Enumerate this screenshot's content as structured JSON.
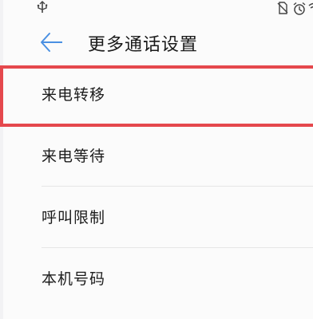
{
  "status_bar": {
    "left_icons": [
      "usb-icon"
    ],
    "right_icons": [
      "no-sim-icon",
      "alarm-icon",
      "wifi-icon"
    ]
  },
  "header": {
    "back_icon": "arrow-left-icon",
    "title": "更多通话设置"
  },
  "menu": {
    "items": [
      {
        "label": "来电转移",
        "highlighted": true
      },
      {
        "label": "来电等待",
        "highlighted": false
      },
      {
        "label": "呼叫限制",
        "highlighted": false
      },
      {
        "label": "本机号码",
        "highlighted": false
      }
    ]
  },
  "colors": {
    "accent": "#4a90e2",
    "highlight": "#e5484d",
    "text": "#1c1c1c",
    "background": "#fbfbfb"
  }
}
